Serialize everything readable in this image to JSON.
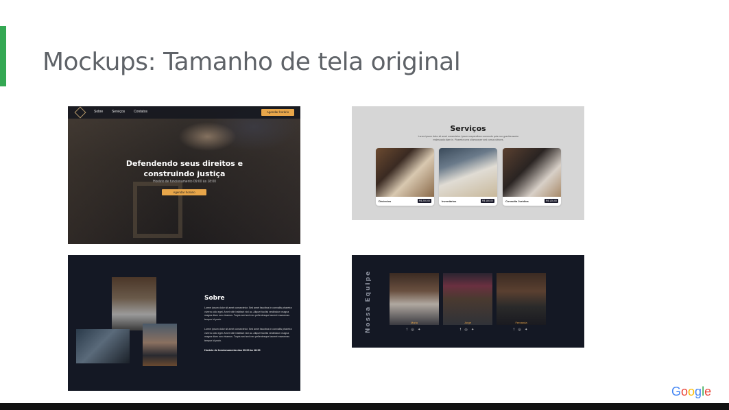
{
  "slide": {
    "title": "Mockups: Tamanho de tela original",
    "logo_text": "Google",
    "accent_color": "#34a853"
  },
  "mockup_hero": {
    "nav": [
      "Sobre",
      "Serviços",
      "Contatos"
    ],
    "nav_button": "Agendar horário",
    "headline_line1": "Defendendo seus direitos e",
    "headline_line2": "construindo justiça",
    "subtext": "Horário de funcionamento 09:00 às 18:00",
    "cta": "Agendar horário"
  },
  "mockup_services": {
    "title": "Serviços",
    "description": "Lorem ipsum dolor sit amet consectetur. Ipsum suspendisse commodo quis non gravida auctor malesuada diam in. Pharetra urna ullamcorper sed cursus ultrices.",
    "cards": [
      {
        "label": "Divórcios",
        "price": "R$ 200,00"
      },
      {
        "label": "Inventários",
        "price": "R$ 180,00"
      },
      {
        "label": "Consulta Jurídica",
        "price": "R$ 120,00"
      }
    ]
  },
  "mockup_about": {
    "title": "Sobre",
    "paragraph1": "Lorem ipsum dolor sit amet consectetur. Sed amet faucibus in convallis pharetra viverra odio eget. Amet nibh habitant nisl ac. Aliquet facilisi vestibulum magna magna diam non vivamus. Turpis sed sed nec pellentesque laoreet maecenas tempor id proin.",
    "paragraph2": "Lorem ipsum dolor sit amet consectetur. Sed amet faucibus in convallis pharetra viverra odio eget. Amet nibh habitant nisl ac. Aliquet facilisi vestibulum magna magna diam non vivamus. Turpis sed sed nec pellentesque laoreet maecenas tempor id proin.",
    "hours": "Horário de funcionamento das 09:00 às 18:00"
  },
  "mockup_team": {
    "heading": "Nossa Equipe",
    "members": [
      {
        "name": "Maria"
      },
      {
        "name": "Jorge"
      },
      {
        "name": "Fernanda"
      }
    ],
    "social_icons": [
      "facebook-icon",
      "instagram-icon",
      "twitter-icon"
    ],
    "social_glyphs": "f ◎ ✦"
  }
}
